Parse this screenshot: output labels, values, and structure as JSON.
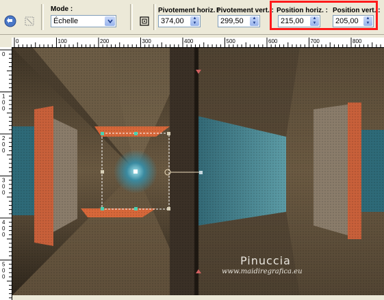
{
  "toolbar": {
    "mode_label": "Mode :",
    "mode_value": "Échelle",
    "pivot_h_label": "Pivotement horiz. :",
    "pivot_h_value": "374,00",
    "pivot_v_label": "Pivotement vert. :",
    "pivot_v_value": "299,50",
    "pos_h_label": "Position horiz. :",
    "pos_h_value": "215,00",
    "pos_v_label": "Position vert. :",
    "pos_v_value": "205,00"
  },
  "ruler": {
    "h_ticks": [
      "0",
      "100",
      "200",
      "300",
      "400",
      "500",
      "600",
      "700",
      "800"
    ],
    "v_ticks": [
      "0",
      "100",
      "200",
      "300",
      "400",
      "500"
    ]
  },
  "watermark": {
    "name": "Pinuccia",
    "url": "www.maidiregrafica.eu"
  },
  "colors": {
    "highlight": "#ff1a1a",
    "accent_orange": "#d8683a",
    "accent_teal": "#3a8aa0",
    "bg_brown": "#5a4a36"
  }
}
